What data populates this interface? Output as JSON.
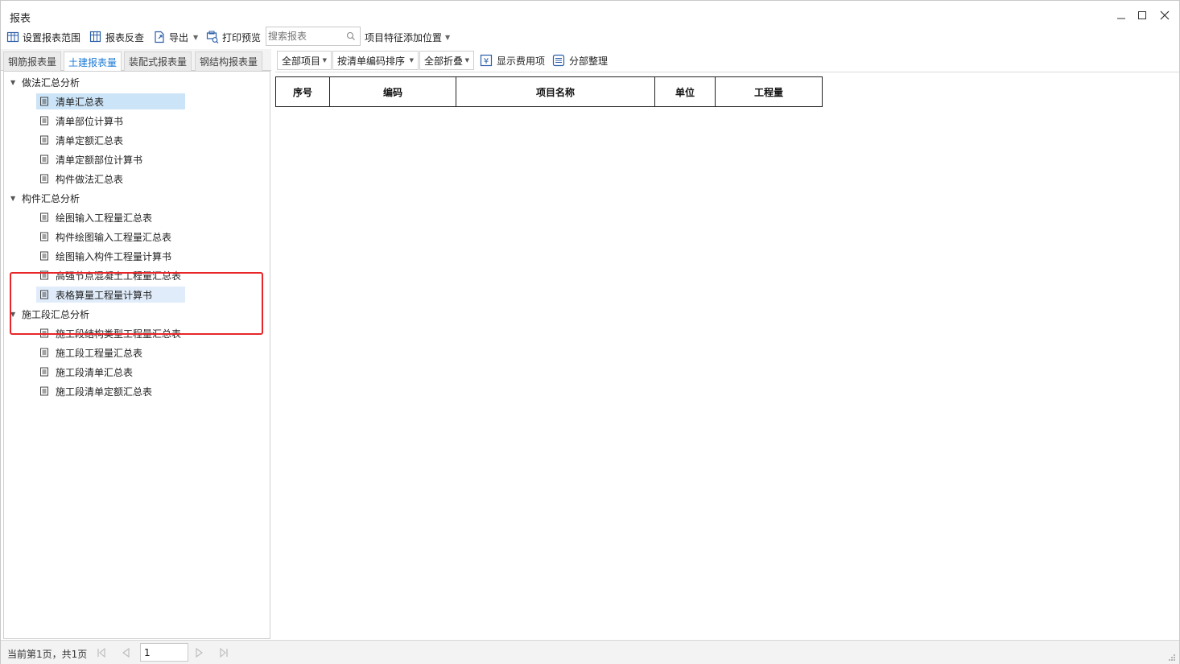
{
  "window": {
    "title": "报表"
  },
  "toolbar": {
    "set_range": "设置报表范围",
    "reverse_check": "报表反查",
    "export": "导出",
    "print_preview": "打印预览",
    "search_placeholder": "搜索报表",
    "feature_position": "项目特征添加位置"
  },
  "tabs": [
    {
      "label": "钢筋报表量"
    },
    {
      "label": "土建报表量"
    },
    {
      "label": "装配式报表量"
    },
    {
      "label": "钢结构报表量"
    }
  ],
  "tree": {
    "groups": [
      {
        "label": "做法汇总分析",
        "items": [
          "清单汇总表",
          "清单部位计算书",
          "清单定额汇总表",
          "清单定额部位计算书",
          "构件做法汇总表"
        ]
      },
      {
        "label": "构件汇总分析",
        "items": [
          "绘图输入工程量汇总表",
          "构件绘图输入工程量汇总表",
          "绘图输入构件工程量计算书",
          "高强节点混凝土工程量汇总表",
          "表格算量工程量计算书"
        ]
      },
      {
        "label": "施工段汇总分析",
        "items": [
          "施工段结构类型工程量汇总表",
          "施工段工程量汇总表",
          "施工段清单汇总表",
          "施工段清单定额汇总表"
        ]
      }
    ]
  },
  "report_toolbar": {
    "all_items": "全部项目",
    "sort_by_code": "按清单编码排序",
    "collapse_all": "全部折叠",
    "show_fees": "显示费用项",
    "organize": "分部整理"
  },
  "table": {
    "headers": [
      "序号",
      "编码",
      "项目名称",
      "单位",
      "工程量"
    ]
  },
  "status": {
    "page_info": "当前第1页，共1页",
    "page_value": "1"
  }
}
